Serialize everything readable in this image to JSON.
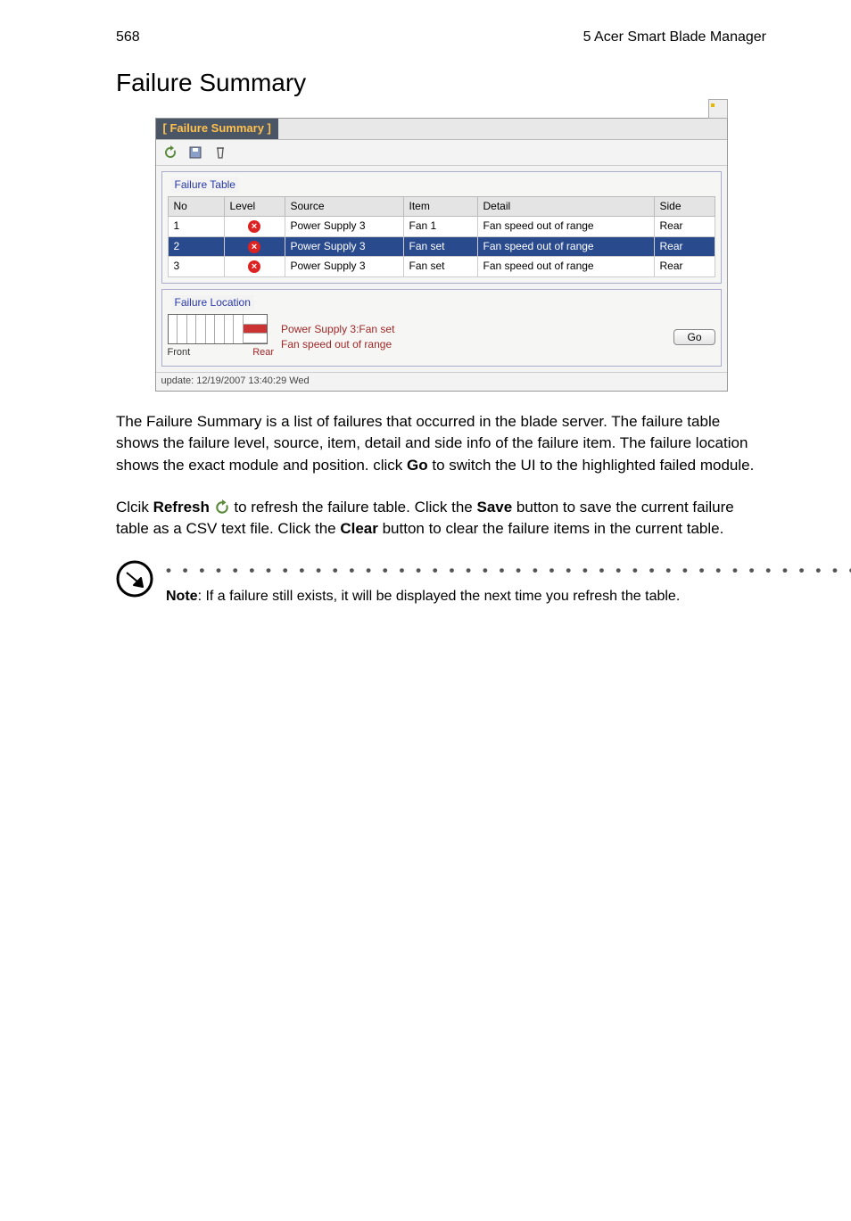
{
  "header": {
    "page_number": "568",
    "chapter": "5 Acer Smart Blade Manager"
  },
  "title": "Failure Summary",
  "screenshot": {
    "panel_title": "[ Failure Summary ]",
    "refresh_icon": "refresh-icon",
    "save_icon": "save-icon",
    "clear_icon": "clear-icon",
    "failure_table": {
      "legend": "Failure Table",
      "columns": [
        "No",
        "Level",
        "Source",
        "Item",
        "Detail",
        "Side"
      ],
      "rows": [
        {
          "no": "1",
          "level": "x",
          "source": "Power Supply 3",
          "item": "Fan 1",
          "detail": "Fan speed out of range",
          "side": "Rear",
          "highlight": false
        },
        {
          "no": "2",
          "level": "x",
          "source": "Power Supply 3",
          "item": "Fan set",
          "detail": "Fan speed out of range",
          "side": "Rear",
          "highlight": true
        },
        {
          "no": "3",
          "level": "x",
          "source": "Power Supply 3",
          "item": "Fan set",
          "detail": "Fan speed out of range",
          "side": "Rear",
          "highlight": false
        }
      ]
    },
    "failure_location": {
      "legend": "Failure Location",
      "line1": "Power Supply 3:Fan set",
      "line2": "Fan speed out of range",
      "front_label": "Front",
      "rear_label": "Rear",
      "go_label": "Go"
    },
    "update_text": "update: 12/19/2007 13:40:29 Wed"
  },
  "body": {
    "p1a": "The Failure Summary is a list of failures that occurred in the blade server. The failure table shows the failure level, source, item, detail and side info of the failure item. The failure location shows the exact module and position. click ",
    "go_word": "Go",
    "p1b": " to switch the UI to the highlighted failed module.",
    "p2a": "Clcik ",
    "refresh_word": "Refresh",
    "p2b": " to refresh the failure table. Click the ",
    "save_word": "Save",
    "p2c": " button to save the current failure table as a CSV text file. Click the ",
    "clear_word": "Clear",
    "p2d": " button to clear the failure items in the current table."
  },
  "note": {
    "dots": "• • • • • • • • • • • • • • • • • • • • • • • • • • • • • • • • • • • • • • • • • • • • •",
    "label": "Note",
    "text": ": If a failure still exists, it will be displayed the next time you refresh the table."
  }
}
